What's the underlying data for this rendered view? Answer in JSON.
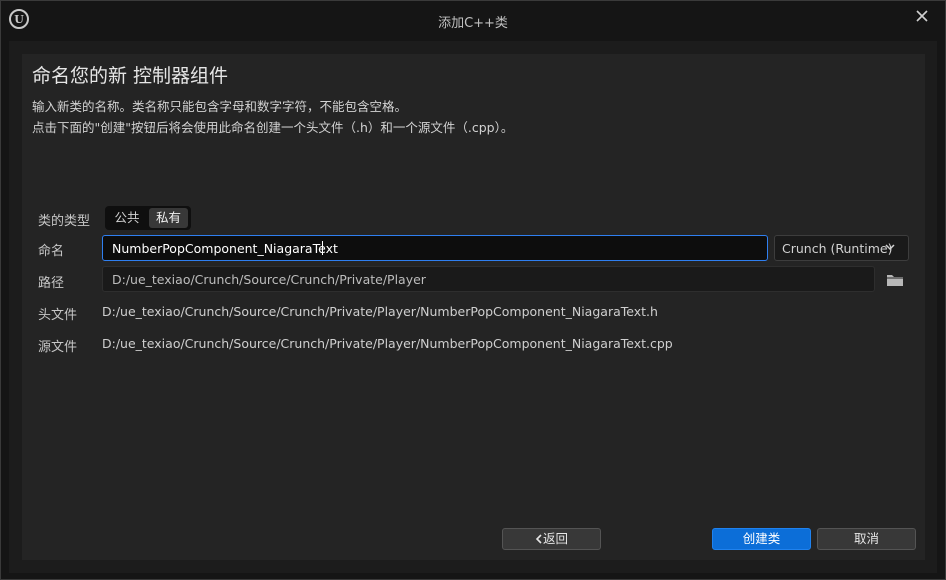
{
  "window": {
    "title": "添加C++类",
    "logo_text": "U"
  },
  "header": {
    "heading": "命名您的新 控制器组件",
    "description_line1": "输入新类的名称。类名称只能包含字母和数字字符，不能包含空格。",
    "description_line2": "点击下面的\"创建\"按钮后将会使用此命名创建一个头文件（.h）和一个源文件（.cpp）。"
  },
  "form": {
    "class_type_label": "类的类型",
    "class_type_options": [
      "公共",
      "私有"
    ],
    "class_type_selected": "私有",
    "name_label": "命名",
    "name_value": "NumberPopComponent_NiagaraText",
    "module_value": "Crunch (Runtime)",
    "path_label": "路径",
    "path_value": "D:/ue_texiao/Crunch/Source/Crunch/Private/Player",
    "header_file_label": "头文件",
    "header_file_value": "D:/ue_texiao/Crunch/Source/Crunch/Private/Player/NumberPopComponent_NiagaraText.h",
    "source_file_label": "源文件",
    "source_file_value": "D:/ue_texiao/Crunch/Source/Crunch/Private/Player/NumberPopComponent_NiagaraText.cpp"
  },
  "buttons": {
    "back": "返回",
    "create": "创建类",
    "cancel": "取消"
  },
  "icons": {
    "close": "close-icon",
    "dropdown": "chevron-down-icon",
    "browse": "folder-icon",
    "back": "chevron-left-icon"
  },
  "colors": {
    "accent": "#0c6ed8",
    "focus_border": "#2f7ff0"
  }
}
